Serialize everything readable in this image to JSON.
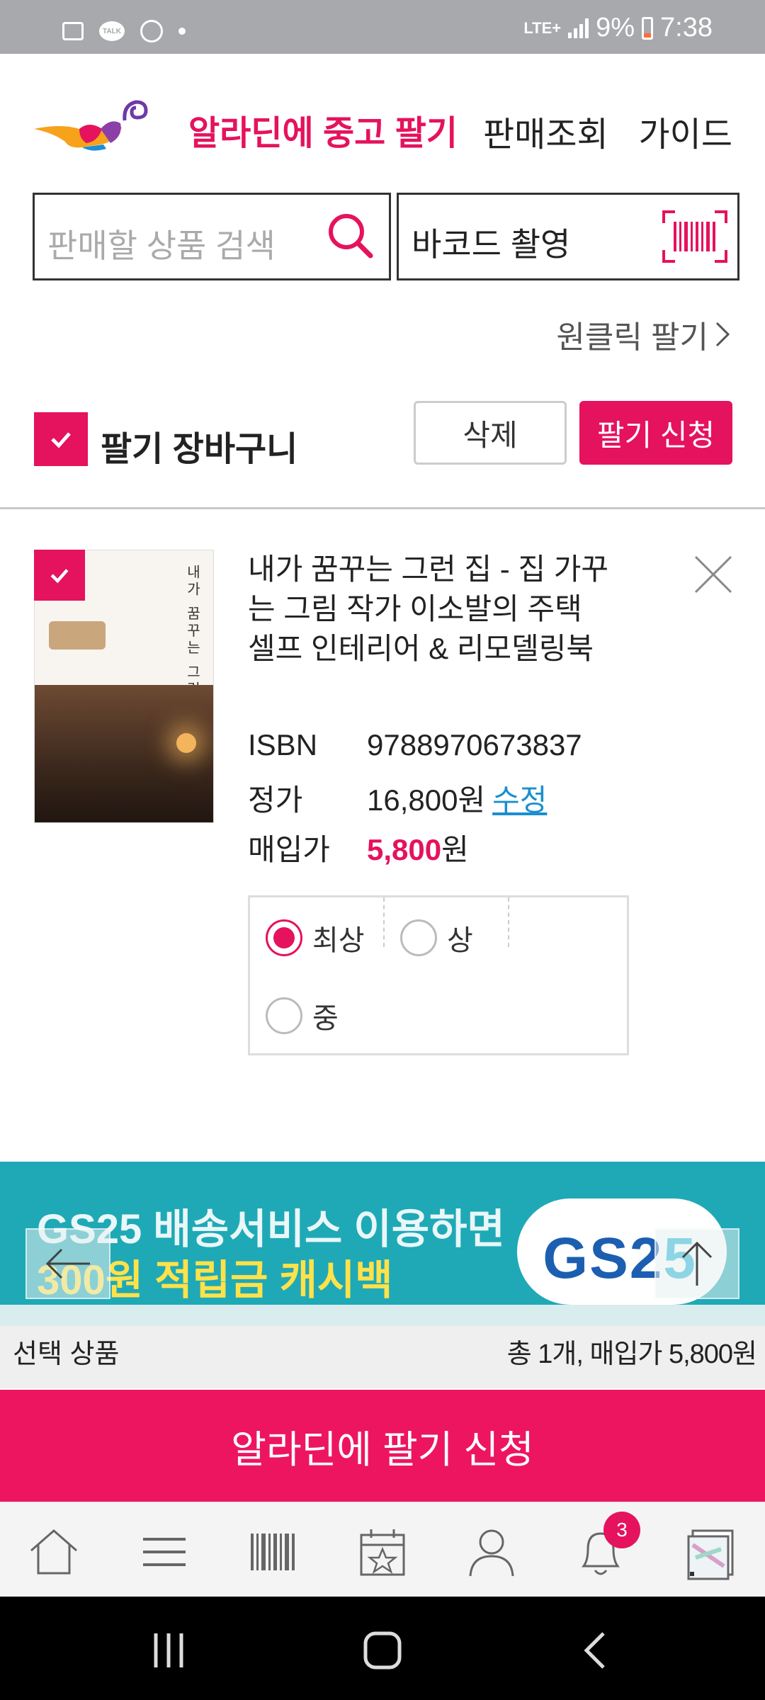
{
  "status_bar": {
    "network": "LTE+",
    "battery": "9%",
    "time": "7:38",
    "talk_icon_text": "TALK"
  },
  "header": {
    "title": "알라딘에 중고 팔기",
    "nav_sales": "판매조회",
    "nav_guide": "가이드"
  },
  "search": {
    "placeholder": "판매할 상품 검색",
    "barcode_label": "바코드 촬영"
  },
  "one_click": "원클릭 팔기",
  "cart": {
    "title": "팔기 장바구니",
    "delete_label": "삭제",
    "apply_label": "팔기 신청",
    "select_all_checked": true
  },
  "product": {
    "title": "내가 꿈꾸는 그런 집 - 집 가꾸는 그림 작가 이소발의 주택 셀프 인테리어 & 리모델링북",
    "cover_title": "내가 꿈꾸는 그런 집",
    "isbn_label": "ISBN",
    "isbn": "9788970673837",
    "list_price_label": "정가",
    "list_price": "16,800원",
    "edit_label": "수정",
    "buy_price_label": "매입가",
    "buy_price": "5,800",
    "buy_price_unit": "원",
    "checked": true,
    "conditions": [
      {
        "label": "최상",
        "selected": true
      },
      {
        "label": "상",
        "selected": false
      },
      {
        "label": "중",
        "selected": false
      }
    ]
  },
  "banner": {
    "line1": "GS25 배송서비스 이용하면",
    "line2": "300원 적립금 캐시백",
    "brand_a": "GS2",
    "brand_b": "5"
  },
  "selection": {
    "label": "선택 상품",
    "summary": "총 1개, 매입가 5,800원"
  },
  "submit_label": "알라딘에 팔기 신청",
  "bottom_nav": {
    "notification_count": "3",
    "items": [
      "home-icon",
      "menu-icon",
      "barcode-icon",
      "calendar-star-icon",
      "user-icon",
      "bell-icon",
      "recent-page-icon"
    ]
  },
  "colors": {
    "accent": "#e5125d",
    "banner_bg": "#1fa9b6",
    "link": "#1a8fcf"
  }
}
